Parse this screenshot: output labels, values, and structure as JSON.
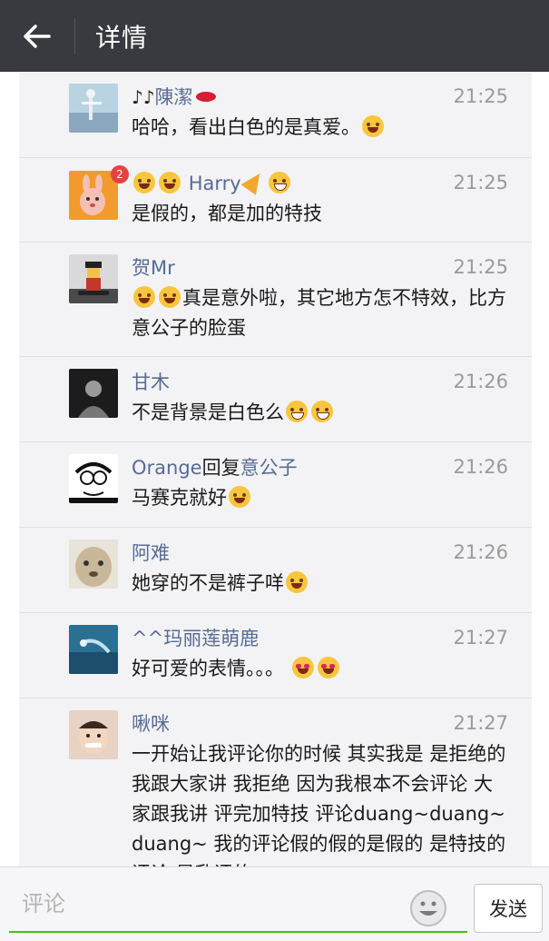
{
  "header": {
    "title": "详情",
    "back_icon": "arrow-left-icon"
  },
  "comments": [
    {
      "name": "陳潔",
      "time": "21:25",
      "text": "哈哈，看出白色的是真爱。"
    },
    {
      "name": "Harry",
      "time": "21:25",
      "text": "是假的，都是加的特技",
      "badge": "2"
    },
    {
      "name": "贺Mr",
      "time": "21:25",
      "text": "真是意外啦，其它地方怎不特效，比方意公子的脸蛋"
    },
    {
      "name": "甘木",
      "time": "21:26",
      "text": "不是背景是白色么"
    },
    {
      "name": "Orange",
      "reply_word": "回复",
      "reply_to": "意公子",
      "time": "21:26",
      "text": "马赛克就好"
    },
    {
      "name": "阿难",
      "time": "21:26",
      "text": "她穿的不是裤子咩"
    },
    {
      "name": "^^玛丽莲萌鹿",
      "time": "21:27",
      "text": "好可爱的表情。。。"
    },
    {
      "name": "啾咪",
      "time": "21:27",
      "text": "一开始让我评论你的时候 其实我是 是拒绝的 我跟大家讲 我拒绝 因为我根本不会评论 大家跟我讲 评完加特技 评论duang~duang~duang~ 我的评论假的假的是假的 是特技的评论 是乱评的"
    }
  ],
  "composer": {
    "placeholder": "评论",
    "send_label": "发送",
    "emoji_icon": "smiley-icon"
  },
  "colors": {
    "topbar": "#393a3f",
    "name_link": "#576b95",
    "input_underline": "#45c01a"
  }
}
